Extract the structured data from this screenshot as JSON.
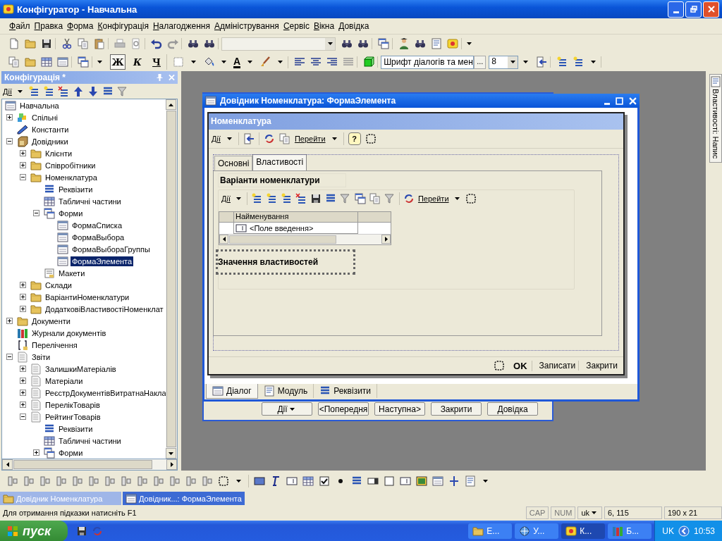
{
  "window": {
    "title": "Конфігуратор - Навчальна"
  },
  "menu": [
    "Файл",
    "Правка",
    "Форма",
    "Конфігурація",
    "Налагодження",
    "Адміністрування",
    "Сервіс",
    "Вікна",
    "Довідка"
  ],
  "format_toolbar": {
    "styles": [
      {
        "kind": "bold",
        "label": "Ж",
        "on": true
      },
      {
        "kind": "italic",
        "label": "К",
        "on": false
      },
      {
        "kind": "underline",
        "label": "Ч",
        "on": false
      }
    ],
    "text_color_glyph": "A",
    "font": "Шрифт діалогів та мен",
    "font_more": "...",
    "size": "8"
  },
  "config_panel": {
    "title": "Конфігурація *",
    "actions": "Дії",
    "tree": {
      "label": "Навчальна",
      "kind": "root",
      "selected": false,
      "children": [
        {
          "label": "Спільні",
          "kind": "common",
          "selected": false,
          "expanded": false
        },
        {
          "label": "Константи",
          "kind": "constants",
          "selected": false
        },
        {
          "label": "Довідники",
          "kind": "catalogs",
          "selected": false,
          "expanded": true,
          "children": [
            {
              "label": "Клієнти",
              "kind": "catalog",
              "selected": false,
              "expanded": false
            },
            {
              "label": "Співробітники",
              "kind": "catalog",
              "selected": false,
              "expanded": false
            },
            {
              "label": "Номенклатура",
              "kind": "catalog",
              "selected": false,
              "expanded": true,
              "children": [
                {
                  "label": "Реквізити",
                  "kind": "attributes",
                  "selected": false
                },
                {
                  "label": "Табличні частини",
                  "kind": "tabular",
                  "selected": false
                },
                {
                  "label": "Форми",
                  "kind": "forms",
                  "selected": false,
                  "expanded": true,
                  "children": [
                    {
                      "label": "ФормаСписка",
                      "kind": "form",
                      "selected": false
                    },
                    {
                      "label": "ФормаВыбора",
                      "kind": "form",
                      "selected": false
                    },
                    {
                      "label": "ФормаВыбораГруппы",
                      "kind": "form",
                      "selected": false
                    },
                    {
                      "label": "ФормаЭлемента",
                      "kind": "form",
                      "selected": true
                    }
                  ]
                },
                {
                  "label": "Макети",
                  "kind": "layouts",
                  "selected": false
                }
              ]
            },
            {
              "label": "Склади",
              "kind": "catalog",
              "selected": false,
              "expanded": false
            },
            {
              "label": "ВаріантиНоменклатури",
              "kind": "catalog",
              "selected": false,
              "expanded": false
            },
            {
              "label": "ДодатковіВластивостіНоменклат",
              "kind": "catalog",
              "selected": false,
              "expanded": false
            }
          ]
        },
        {
          "label": "Документи",
          "kind": "documents",
          "selected": false,
          "expanded": false
        },
        {
          "label": "Журнали документів",
          "kind": "journals",
          "selected": false
        },
        {
          "label": "Перелічення",
          "kind": "enums",
          "selected": false
        },
        {
          "label": "Звіти",
          "kind": "reports",
          "selected": false,
          "expanded": true,
          "children": [
            {
              "label": "ЗалишкиМатеріалів",
              "kind": "report",
              "selected": false,
              "expanded": false
            },
            {
              "label": "Матеріали",
              "kind": "report",
              "selected": false,
              "expanded": false
            },
            {
              "label": "РеєстрДокументівВитратнаНакла",
              "kind": "report",
              "selected": false,
              "expanded": false
            },
            {
              "label": "ПерелікТоварів",
              "kind": "report",
              "selected": false,
              "expanded": false
            },
            {
              "label": "РейтингТоварів",
              "kind": "report",
              "selected": false,
              "expanded": true,
              "children": [
                {
                  "label": "Реквізити",
                  "kind": "attributes",
                  "selected": false
                },
                {
                  "label": "Табличні частини",
                  "kind": "tabular",
                  "selected": false
                },
                {
                  "label": "Форми",
                  "kind": "forms",
                  "selected": false,
                  "expanded": false
                }
              ]
            }
          ]
        }
      ]
    }
  },
  "back_window": {
    "buttons": [
      {
        "label": "Дії",
        "kind": "menu"
      },
      {
        "label": "<Попередня",
        "kind": "plain"
      },
      {
        "label": "Наступна>",
        "kind": "plain"
      },
      {
        "label": "Закрити",
        "kind": "plain"
      },
      {
        "label": "Довідка",
        "kind": "plain"
      }
    ]
  },
  "editor": {
    "title": "Довідник Номенклатура: ФормаЭлемента",
    "form": {
      "title": "Номенклатура",
      "toolbar": {
        "actions": "Дії",
        "goto": "Перейти",
        "help": "?"
      },
      "tabs": [
        {
          "label": "Основні",
          "selected": false
        },
        {
          "label": "Властивості",
          "selected": true
        }
      ],
      "group_title": "Варіанти номенклатури",
      "group_toolbar": {
        "actions": "Дії",
        "goto": "Перейти"
      },
      "table": {
        "columns": [
          "Найменування"
        ],
        "rows": [
          [
            "<Поле введення>"
          ]
        ]
      },
      "selected_label": "Значення властивостей",
      "footer": {
        "ok": "OK",
        "buttons": [
          "Записати",
          "Закрити"
        ]
      }
    },
    "tabs": [
      {
        "label": "Діалог",
        "kind": "dialog",
        "selected": true
      },
      {
        "label": "Модуль",
        "kind": "module",
        "selected": false
      },
      {
        "label": "Реквізити",
        "kind": "attributes",
        "selected": false
      }
    ]
  },
  "properties_tab": "Властивості: Напис",
  "window_tabs": [
    {
      "label": "Довідник Номенклатура",
      "kind": "catalog",
      "selected": false
    },
    {
      "label": "Довідник...: ФормаЭлемента",
      "kind": "form",
      "selected": true
    }
  ],
  "status_bar": {
    "hint": "Для отримання підказки натисніть F1",
    "cap": "CAP",
    "num": "NUM",
    "lang": "uk",
    "position": "6, 115",
    "size": "190 x 21"
  },
  "taskbar": {
    "start": "пуск",
    "tasks": [
      {
        "label": "Е...",
        "kind": "folder",
        "selected": false
      },
      {
        "label": "У...",
        "kind": "browser",
        "selected": false
      },
      {
        "label": "К...",
        "kind": "config",
        "selected": true
      },
      {
        "label": "Б...",
        "kind": "books",
        "selected": false
      }
    ],
    "lang": "UK",
    "clock": "10:53"
  }
}
